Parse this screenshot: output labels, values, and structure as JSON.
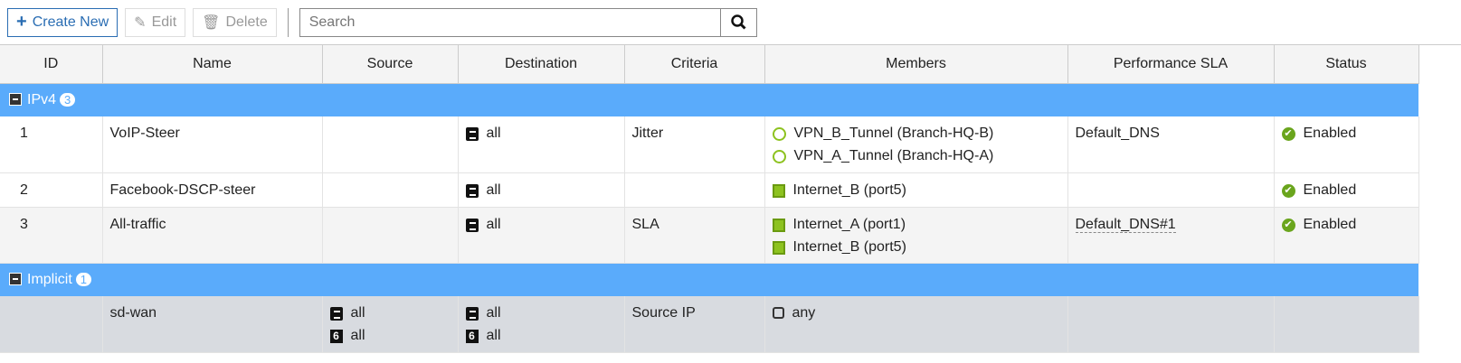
{
  "toolbar": {
    "create": "Create New",
    "edit": "Edit",
    "delete": "Delete",
    "search_placeholder": "Search"
  },
  "columns": [
    "ID",
    "Name",
    "Source",
    "Destination",
    "Criteria",
    "Members",
    "Performance SLA",
    "Status"
  ],
  "groups": [
    {
      "label": "IPv4",
      "count": "3",
      "rows": [
        {
          "id": "1",
          "name": "VoIP-Steer",
          "source": [],
          "destination": [
            {
              "icon": "address",
              "text": "all"
            }
          ],
          "criteria": "Jitter",
          "members": [
            {
              "icon": "vpn",
              "text": "VPN_B_Tunnel (Branch-HQ-B)"
            },
            {
              "icon": "vpn",
              "text": "VPN_A_Tunnel (Branch-HQ-A)"
            }
          ],
          "sla": "Default_DNS",
          "status": "Enabled"
        },
        {
          "id": "2",
          "name": "Facebook-DSCP-steer",
          "source": [],
          "destination": [
            {
              "icon": "address",
              "text": "all"
            }
          ],
          "criteria": "",
          "members": [
            {
              "icon": "port",
              "text": "Internet_B (port5)"
            }
          ],
          "sla": "",
          "status": "Enabled"
        },
        {
          "id": "3",
          "name": "All-traffic",
          "source": [],
          "destination": [
            {
              "icon": "address",
              "text": "all"
            }
          ],
          "criteria": "SLA",
          "members": [
            {
              "icon": "port",
              "text": "Internet_A (port1)"
            },
            {
              "icon": "port",
              "text": "Internet_B (port5)"
            }
          ],
          "sla": "Default_DNS#1",
          "status": "Enabled"
        }
      ]
    },
    {
      "label": "Implicit",
      "count": "1",
      "rows": [
        {
          "id": "",
          "name": "sd-wan",
          "source": [
            {
              "icon": "address",
              "text": "all"
            },
            {
              "icon": "address6",
              "text": "all"
            }
          ],
          "destination": [
            {
              "icon": "address",
              "text": "all"
            },
            {
              "icon": "address6",
              "text": "all"
            }
          ],
          "criteria": "Source IP",
          "members": [
            {
              "icon": "any",
              "text": "any"
            }
          ],
          "sla": "",
          "status": ""
        }
      ]
    }
  ]
}
